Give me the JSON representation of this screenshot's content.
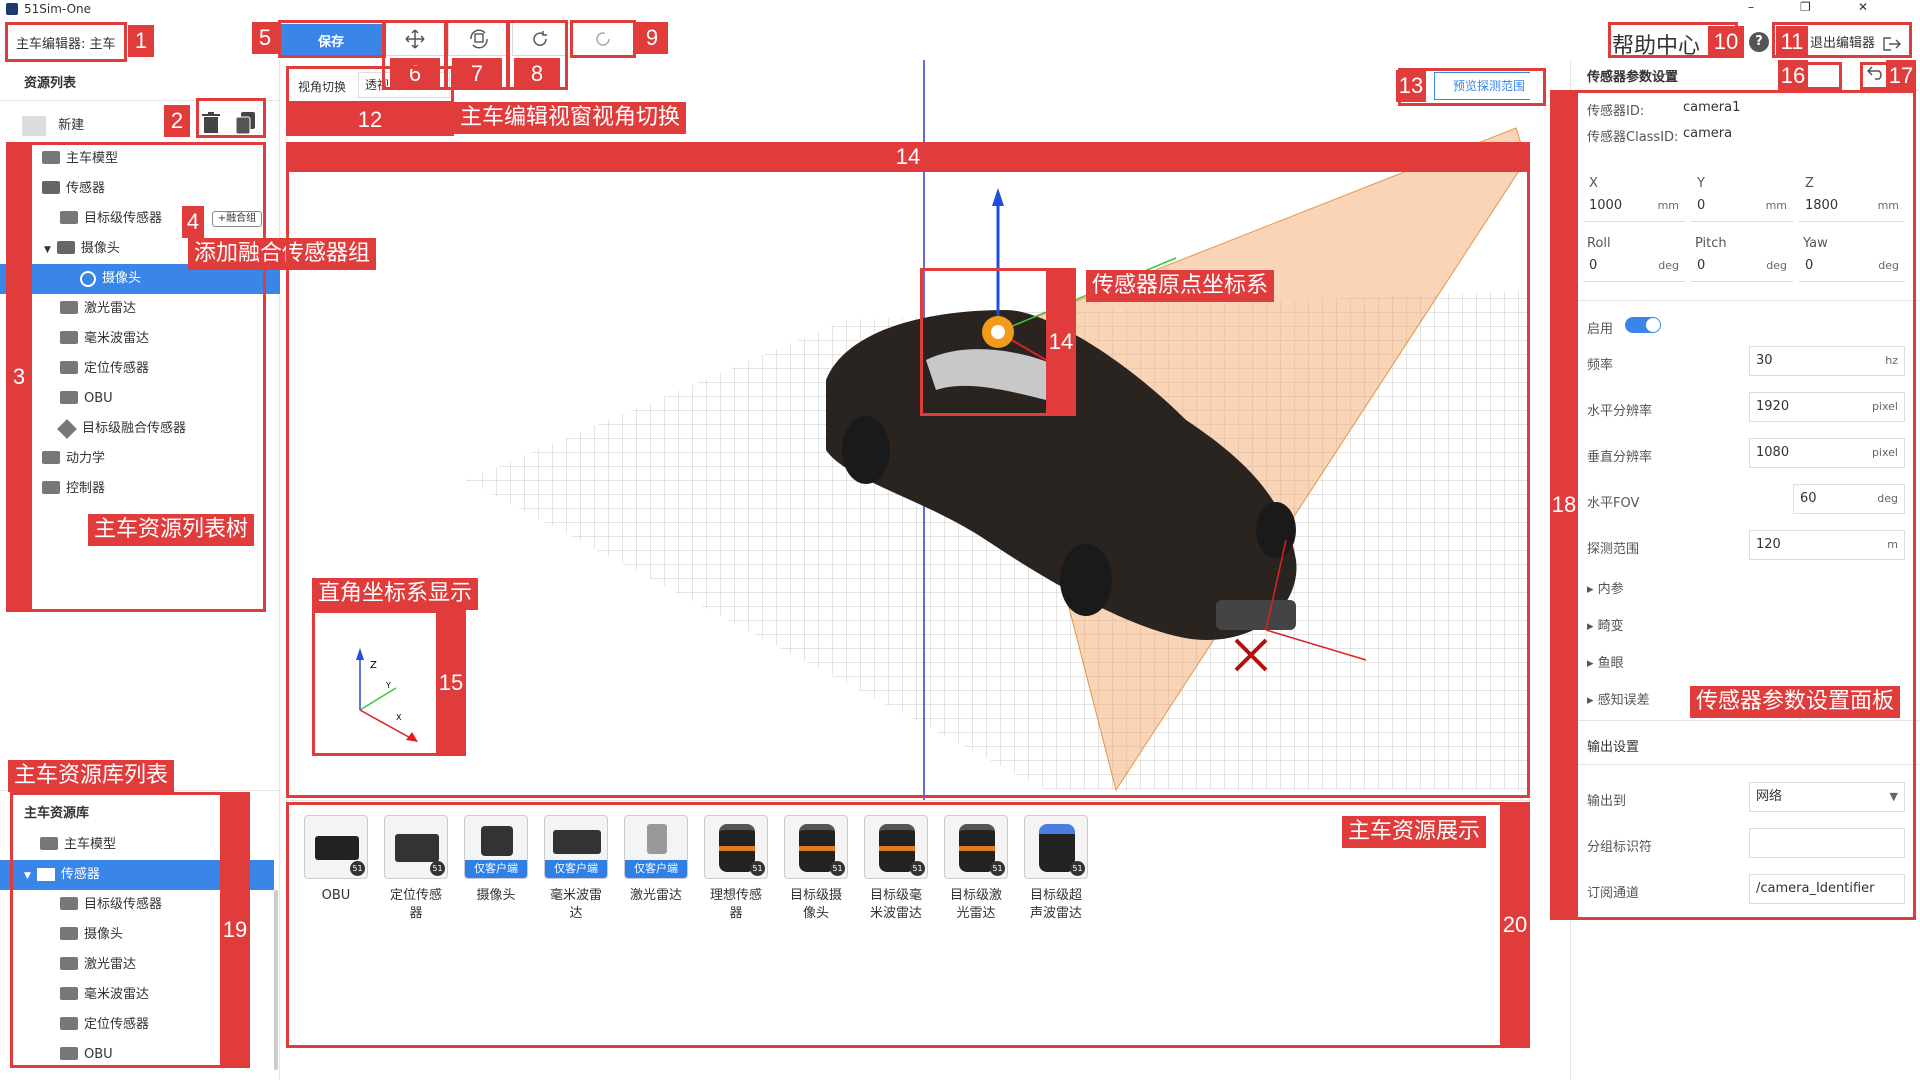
{
  "window": {
    "title": "51Sim-One",
    "minimize": "–",
    "maximize": "❐",
    "close": "✕"
  },
  "editor": {
    "title": "主车编辑器: 主车"
  },
  "toolbar": {
    "save_label": "保存"
  },
  "help": {
    "label": "帮助中心",
    "icon": "?"
  },
  "exit": {
    "label": "退出编辑器"
  },
  "left": {
    "resource_list_title": "资源列表",
    "new_label": "新建",
    "fusion_button": "+融合组",
    "tree": [
      {
        "label": "主车模型"
      },
      {
        "label": "传感器"
      },
      {
        "label": "目标级传感器"
      },
      {
        "label": "摄像头"
      },
      {
        "label": "摄像头"
      },
      {
        "label": "激光雷达"
      },
      {
        "label": "毫米波雷达"
      },
      {
        "label": "定位传感器"
      },
      {
        "label": "OBU"
      },
      {
        "label": "目标级融合传感器"
      },
      {
        "label": "动力学"
      },
      {
        "label": "控制器"
      }
    ],
    "library_title": "主车资源库",
    "library": [
      {
        "label": "主车模型"
      },
      {
        "label": "传感器"
      },
      {
        "label": "目标级传感器"
      },
      {
        "label": "摄像头"
      },
      {
        "label": "激光雷达"
      },
      {
        "label": "毫米波雷达"
      },
      {
        "label": "定位传感器"
      },
      {
        "label": "OBU"
      }
    ]
  },
  "viewport": {
    "view_switch_label": "视角切换",
    "view_select_value": "透视图",
    "preview_button": "预览探测范围",
    "axis_labels": {
      "z": "Z",
      "y": "Y",
      "x": "X"
    }
  },
  "resources": [
    {
      "label": "OBU",
      "tag": ""
    },
    {
      "label": "定位传感器",
      "tag": ""
    },
    {
      "label": "摄像头",
      "tag": "仅客户端"
    },
    {
      "label": "毫米波雷达",
      "tag": "仅客户端"
    },
    {
      "label": "激光雷达",
      "tag": "仅客户端"
    },
    {
      "label": "理想传感器",
      "tag": ""
    },
    {
      "label": "目标级摄像头",
      "tag": ""
    },
    {
      "label": "目标级毫米波雷达",
      "tag": ""
    },
    {
      "label": "目标级激光雷达",
      "tag": ""
    },
    {
      "label": "目标级超声波雷达",
      "tag": ""
    }
  ],
  "badge": "51",
  "params": {
    "title": "传感器参数设置",
    "sensor_id_label": "传感器ID:",
    "sensor_id_value": "camera1",
    "class_id_label": "传感器ClassID:",
    "class_id_value": "camera",
    "x_label": "X",
    "x_value": "1000",
    "x_unit": "mm",
    "y_label": "Y",
    "y_value": "0",
    "y_unit": "mm",
    "z_label": "Z",
    "z_value": "1800",
    "z_unit": "mm",
    "roll_label": "Roll",
    "roll_value": "0",
    "roll_unit": "deg",
    "pitch_label": "Pitch",
    "pitch_value": "0",
    "pitch_unit": "deg",
    "yaw_label": "Yaw",
    "yaw_value": "0",
    "yaw_unit": "deg",
    "enable_label": "启用",
    "freq_label": "频率",
    "freq_value": "30",
    "freq_unit": "hz",
    "hres_label": "水平分辨率",
    "hres_value": "1920",
    "hres_unit": "pixel",
    "vres_label": "垂直分辨率",
    "vres_value": "1080",
    "vres_unit": "pixel",
    "fov_label": "水平FOV",
    "fov_value": "60",
    "fov_unit": "deg",
    "range_label": "探测范围",
    "range_value": "120",
    "range_unit": "m",
    "sections": [
      "内参",
      "畸变",
      "鱼眼",
      "感知误差"
    ],
    "output_title": "输出设置",
    "output_to_label": "输出到",
    "output_to_value": "网络",
    "group_label": "分组标识符",
    "group_value": "",
    "channel_label": "订阅通道",
    "channel_value": "/camera_Identifier"
  },
  "annotations": {
    "n1": "1",
    "n2": "2",
    "n3": "3",
    "n4": "4",
    "n5": "5",
    "n6": "6",
    "n7": "7",
    "n8": "8",
    "n9": "9",
    "n10": "10",
    "n11": "11",
    "n12": "12",
    "n13": "13",
    "n14": "14",
    "n14b": "14",
    "n15": "15",
    "n16": "16",
    "n17": "17",
    "n18": "18",
    "n19": "19",
    "n20": "20",
    "fusion_group": "添加融合传感器组",
    "resource_tree": "主车资源列表树",
    "view_switch": "主车编辑视窗视角切换",
    "sensor_origin": "传感器原点坐标系",
    "cartesian": "直角坐标系显示",
    "library_list": "主车资源库列表",
    "resource_display": "主车资源展示",
    "param_panel": "传感器参数设置面板"
  },
  "colors": {
    "accent": "#2f7fe8",
    "annotation": "#e03c3c",
    "toggle": "#3a86e8"
  }
}
